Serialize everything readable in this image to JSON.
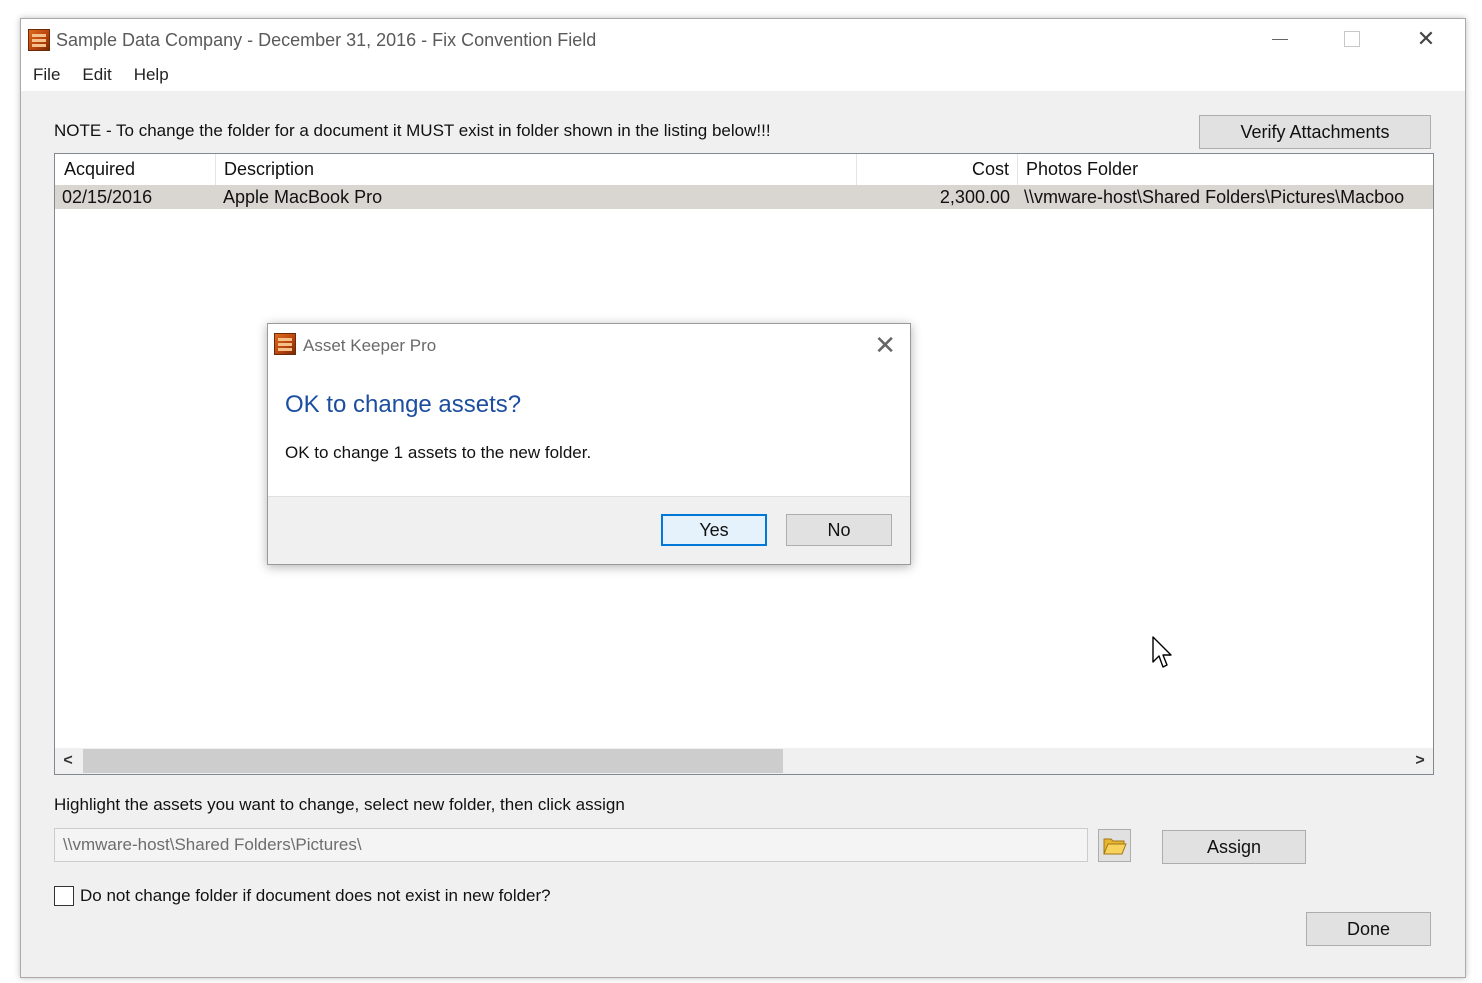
{
  "window": {
    "title": "Sample Data Company - December 31, 2016 - Fix Convention Field"
  },
  "menu": {
    "items": [
      "File",
      "Edit",
      "Help"
    ]
  },
  "note": "NOTE - To change the folder for a document it MUST exist in folder shown in the listing below!!!",
  "verify_button": "Verify Attachments",
  "table": {
    "columns": [
      "Acquired",
      "Description",
      "Cost",
      "Photos Folder"
    ],
    "rows": [
      {
        "acquired": "02/15/2016",
        "description": "Apple MacBook Pro",
        "cost": "2,300.00",
        "folder": "\\\\vmware-host\\Shared Folders\\Pictures\\Macboo"
      }
    ]
  },
  "hint": "Highlight the assets you want to change, select new folder, then click assign",
  "folder_input": {
    "value": "\\\\vmware-host\\Shared Folders\\Pictures\\"
  },
  "assign_button": "Assign",
  "checkbox": {
    "label": "Do not change folder if document does not exist in new folder?",
    "checked": false
  },
  "done_button": "Done",
  "dialog": {
    "title": "Asset Keeper Pro",
    "heading": "OK to change assets?",
    "message": "OK to change 1 assets to the new folder.",
    "yes": "Yes",
    "no": "No"
  },
  "colors": {
    "accent": "#0078d7",
    "heading_blue": "#1c4ea0",
    "selected_row": "#d9d5d1"
  }
}
